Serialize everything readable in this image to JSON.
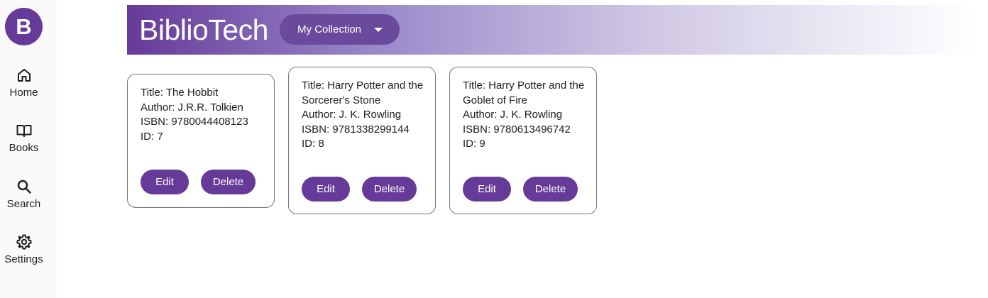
{
  "app": {
    "logo_letter": "B",
    "title": "BiblioTech",
    "brand_color": "#663a99"
  },
  "nav": [
    {
      "label": "Home",
      "icon": "home-icon"
    },
    {
      "label": "Books",
      "icon": "book-icon"
    },
    {
      "label": "Search",
      "icon": "search-icon"
    },
    {
      "label": "Settings",
      "icon": "gear-icon"
    }
  ],
  "header": {
    "collection_label": "My Collection",
    "dropdown_icon": "caret-down-icon"
  },
  "books": [
    {
      "title": "Title: The Hobbit",
      "author": "Author: J.R.R. Tolkien",
      "isbn": "ISBN: 9780044408123",
      "id": "ID: 7",
      "edit_label": "Edit",
      "delete_label": "Delete"
    },
    {
      "title": "Title: Harry Potter and the Sorcerer's Stone",
      "author": "Author: J. K. Rowling",
      "isbn": "ISBN: 9781338299144",
      "id": "ID: 8",
      "edit_label": "Edit",
      "delete_label": "Delete"
    },
    {
      "title": "Title: Harry Potter and the Goblet of Fire",
      "author": "Author: J. K. Rowling",
      "isbn": "ISBN: 9780613496742",
      "id": "ID: 9",
      "edit_label": "Edit",
      "delete_label": "Delete"
    }
  ]
}
